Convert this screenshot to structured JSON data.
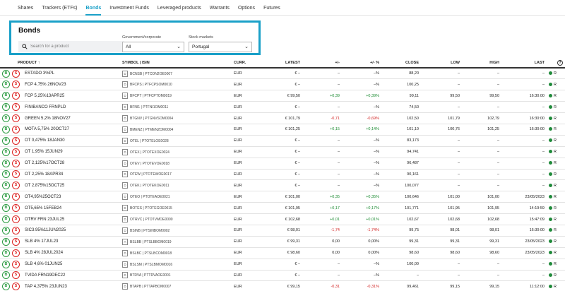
{
  "tabs": [
    {
      "label": "Shares"
    },
    {
      "label": "Trackers (ETFs)"
    },
    {
      "label": "Bonds",
      "active": true
    },
    {
      "label": "Investment Funds"
    },
    {
      "label": "Leveraged products"
    },
    {
      "label": "Warrants"
    },
    {
      "label": "Options"
    },
    {
      "label": "Futures"
    }
  ],
  "filter": {
    "title": "Bonds",
    "search_placeholder": "Search for a product",
    "type_label": "Government/corporate",
    "type_value": "All",
    "market_label": "Stock markets",
    "market_value": "Portugal"
  },
  "table": {
    "headers": {
      "product": "PRODUCT ↑",
      "symbol": "SYMBOL | ISIN",
      "curr": "CURR.",
      "latest": "LATEST",
      "change": "+/-",
      "change_pct": "+/- %",
      "close": "CLOSE",
      "low": "LOW",
      "high": "HIGH",
      "last": "LAST"
    },
    "buy_label": "B",
    "sell_label": "S",
    "rows": [
      {
        "name": "ESTADO 3%PL",
        "icon": "D",
        "symbol": "BCNSB | PTCON2OE0007",
        "curr": "EUR",
        "latest": "€ –",
        "chg": "–",
        "pct": "–%",
        "close": "88,20",
        "low": "–",
        "high": "–",
        "last": "–",
        "mkt": "R"
      },
      {
        "name": "FCP 4,75% 26NOV23",
        "icon": "D",
        "symbol": "BFCPS | PTFCPSOM0010",
        "curr": "EUR",
        "latest": "€ –",
        "chg": "–",
        "pct": "–%",
        "close": "100,25",
        "low": "–",
        "high": "–",
        "last": "–",
        "mkt": "R"
      },
      {
        "name": "FCP 5,25%13APR25",
        "icon": "D",
        "symbol": "BFCPT | PTFCPTOM0019",
        "curr": "EUR",
        "latest": "€ 99,50",
        "chg": "+0,39",
        "pct": "+0,39%",
        "close": "99,11",
        "low": "99,50",
        "high": "99,50",
        "last": "16:30:00",
        "mkt": "R"
      },
      {
        "name": "FINIBANCO FRNPLD",
        "icon": "D",
        "symbol": "BFNI1 | PTFNI1OM0011",
        "curr": "EUR",
        "latest": "€ –",
        "chg": "–",
        "pct": "–%",
        "close": "74,50",
        "low": "–",
        "high": "–",
        "last": "–",
        "mkt": "R"
      },
      {
        "name": "GREEN 5,2% 18NOV27",
        "icon": "D",
        "symbol": "BTGNV | PTGNVSOM0004",
        "curr": "EUR",
        "latest": "€ 101,79",
        "chg": "-0,71",
        "pct": "-0,69%",
        "close": "102,50",
        "low": "101,79",
        "high": "102,79",
        "last": "16:30:00",
        "mkt": "R"
      },
      {
        "name": "MOTA 5,75% 20OCT27",
        "icon": "D",
        "symbol": "BMENZ | PTMENZOM0004",
        "curr": "EUR",
        "latest": "€ 101,25",
        "chg": "+0,15",
        "pct": "+0,14%",
        "close": "101,10",
        "low": "100,76",
        "high": "101,25",
        "last": "16:30:00",
        "mkt": "R"
      },
      {
        "name": "OT 0,475% 18JAN30",
        "icon": "D",
        "symbol": "OTEL | PTOTELOE0028",
        "curr": "EUR",
        "latest": "€ –",
        "chg": "–",
        "pct": "–%",
        "close": "83,173",
        "low": "–",
        "high": "–",
        "last": "–",
        "mkt": "R"
      },
      {
        "name": "OT 1,95% 15JUN29",
        "icon": "D",
        "symbol": "OTEX | PTOTEXOE0024",
        "curr": "EUR",
        "latest": "€ –",
        "chg": "–",
        "pct": "–%",
        "close": "94,741",
        "low": "–",
        "high": "–",
        "last": "–",
        "mkt": "R"
      },
      {
        "name": "OT 2,125%17OCT28",
        "icon": "D",
        "symbol": "OTEV | PTOTEVOE0018",
        "curr": "EUR",
        "latest": "€ –",
        "chg": "–",
        "pct": "–%",
        "close": "96,487",
        "low": "–",
        "high": "–",
        "last": "–",
        "mkt": "R"
      },
      {
        "name": "OT 2,25% 18APR34",
        "icon": "D",
        "symbol": "OTEW | PTOTEWOE0017",
        "curr": "EUR",
        "latest": "€ –",
        "chg": "–",
        "pct": "–%",
        "close": "90,161",
        "low": "–",
        "high": "–",
        "last": "–",
        "mkt": "R"
      },
      {
        "name": "OT 2,875%15OCT25",
        "icon": "D",
        "symbol": "OTEK | PTOTEKOE0011",
        "curr": "EUR",
        "latest": "€ –",
        "chg": "–",
        "pct": "–%",
        "close": "100,077",
        "low": "–",
        "high": "–",
        "last": "–",
        "mkt": "R"
      },
      {
        "name": "OT4,95%25OCT23",
        "icon": "D",
        "symbol": "OTEO | PTOTEAOE0021",
        "curr": "EUR",
        "latest": "€ 101,00",
        "chg": "+0,35",
        "pct": "+0,35%",
        "close": "100,646",
        "low": "101,00",
        "high": "101,00",
        "last": "23/05/2023",
        "mkt": "R"
      },
      {
        "name": "OT5,65% 15FEB24",
        "icon": "D",
        "symbol": "BOTES | PTOTEGOE0015",
        "curr": "EUR",
        "latest": "€ 101,95",
        "chg": "+0,17",
        "pct": "+0,17%",
        "close": "101,771",
        "low": "101,95",
        "high": "101,95",
        "last": "14:19:59",
        "mkt": "R"
      },
      {
        "name": "OTRV FRN 23JUL25",
        "icon": "D",
        "symbol": "OTRVC | PTOTVMOE0000",
        "curr": "EUR",
        "latest": "€ 102,68",
        "chg": "+0,01",
        "pct": "+0,01%",
        "close": "102,67",
        "low": "102,68",
        "high": "102,68",
        "last": "15:47:09",
        "mkt": "R"
      },
      {
        "name": "SIC3.95%11JUN2025",
        "icon": "D",
        "symbol": "BSINB | PTSINBOM0002",
        "curr": "EUR",
        "latest": "€ 98,01",
        "chg": "-1,74",
        "pct": "-1,74%",
        "close": "99,75",
        "low": "98,01",
        "high": "98,01",
        "last": "16:30:00",
        "mkt": "R"
      },
      {
        "name": "SLB 4% 17JUL23",
        "icon": "A",
        "symbol": "BSLBB | PTSLBBOM0019",
        "curr": "EUR",
        "latest": "€ 99,31",
        "chg": "0,00",
        "pct": "0,00%",
        "close": "99,31",
        "low": "99,31",
        "high": "99,31",
        "last": "23/05/2023",
        "mkt": "R"
      },
      {
        "name": "SLB 4% 28JUL2024",
        "icon": "D",
        "symbol": "BSLBC | PTSLBCOM0018",
        "curr": "EUR",
        "latest": "€ 98,60",
        "chg": "0,00",
        "pct": "0,00%",
        "close": "98,60",
        "low": "98,60",
        "high": "98,60",
        "last": "23/05/2023",
        "mkt": "R"
      },
      {
        "name": "SLB 4,6% 01JUN25",
        "icon": "D",
        "symbol": "BSLSM | PTSLBMOM0016",
        "curr": "EUR",
        "latest": "€ –",
        "chg": "–",
        "pct": "–%",
        "close": "100,00",
        "low": "–",
        "high": "–",
        "last": "–",
        "mkt": "R"
      },
      {
        "name": "TVIDA FRN19DEC22",
        "icon": "D",
        "symbol": "BTRVA | PTTRVAOE0001",
        "curr": "EUR",
        "latest": "€ –",
        "chg": "–",
        "pct": "–%",
        "close": "–",
        "low": "–",
        "high": "–",
        "last": "–",
        "mkt": "R"
      },
      {
        "name": "TAP 4,375% 23JUN23",
        "icon": "D",
        "symbol": "BTAPB | PTTAPBOM0007",
        "curr": "EUR",
        "latest": "€ 99,15",
        "chg": "-0,31",
        "pct": "-0,31%",
        "close": "99,461",
        "low": "99,15",
        "high": "99,15",
        "last": "11:12:00",
        "mkt": "R"
      }
    ]
  },
  "colors": {
    "accent": "#1aa0c8",
    "positive": "#1a8a30",
    "negative": "#d22222",
    "market_dot": "#1f8a3a"
  }
}
